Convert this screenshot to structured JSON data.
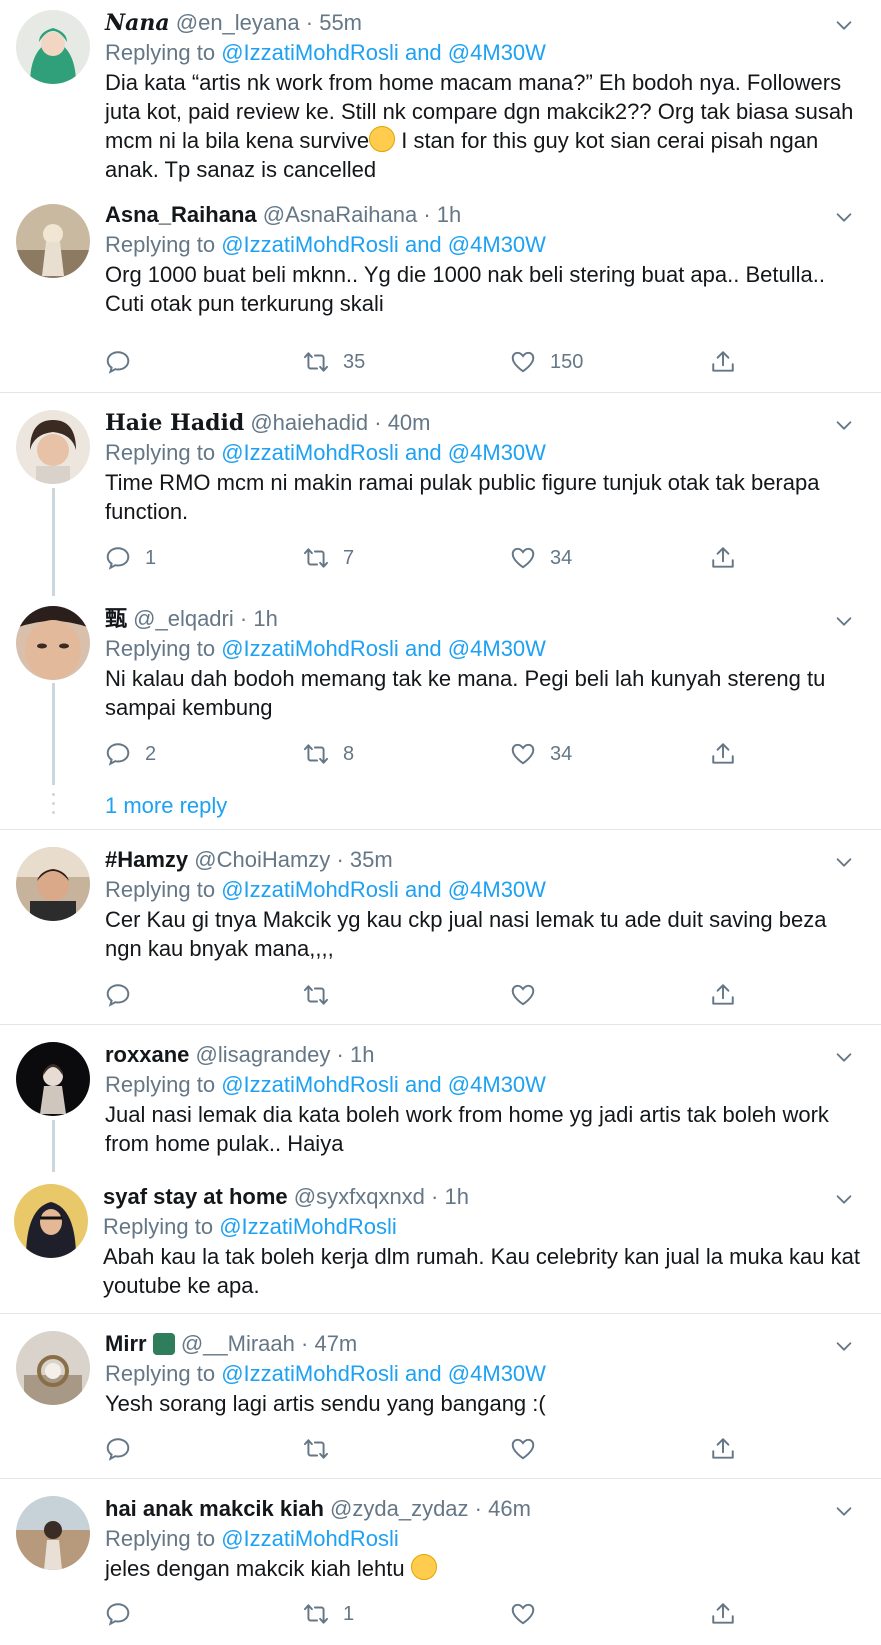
{
  "reply_prefix": "Replying to",
  "tweets": [
    {
      "name": "𝑵𝒂𝒏𝒂",
      "handle": "@en_leyana",
      "time": "55m",
      "mention_a": "@IzzatiMohdRosli",
      "and": "and",
      "mention_b": "@4M30W",
      "text_1": "Dia kata “artis nk work from home macam mana?” Eh bodoh nya. Followers juta kot, paid review ke. Still nk compare dgn makcik2?? Org tak biasa susah mcm ni la bila kena survive",
      "text_2": " I stan for this guy kot sian cerai pisah ngan anak. Tp sanaz is cancelled"
    },
    {
      "name": "Asna_Raihana",
      "handle": "@AsnaRaihana",
      "time": "1h",
      "mention_a": "@IzzatiMohdRosli",
      "and": "and",
      "mention_b": "@4M30W",
      "text": "Org 1000 buat beli mknn.. Yg die 1000 nak beli stering buat apa.. Betulla.. Cuti otak pun terkurung skali",
      "retweets": "35",
      "likes": "150"
    },
    {
      "name": "Haie Hadid",
      "handle": "@haiehadid",
      "time": "40m",
      "mention_a": "@IzzatiMohdRosli",
      "and": "and",
      "mention_b": "@4M30W",
      "text": "Time RMO mcm ni makin ramai pulak public figure tunjuk otak tak berapa function.",
      "replies": "1",
      "retweets": "7",
      "likes": "34"
    },
    {
      "name": "甄",
      "handle": "@_elqadri",
      "time": "1h",
      "mention_a": "@IzzatiMohdRosli",
      "and": "and",
      "mention_b": "@4M30W",
      "text": "Ni kalau dah bodoh memang tak ke mana. Pegi beli lah kunyah stereng tu sampai kembung",
      "replies": "2",
      "retweets": "8",
      "likes": "34"
    },
    {
      "name": "#Hamzy",
      "handle": "@ChoiHamzy",
      "time": "35m",
      "mention_a": "@IzzatiMohdRosli",
      "and": "and",
      "mention_b": "@4M30W",
      "text": "Cer Kau gi tnya Makcik yg kau ckp jual nasi lemak tu ade duit saving beza ngn kau bnyak mana,,,,"
    },
    {
      "name": "roxxane",
      "handle": "@lisagrandey",
      "time": "1h",
      "mention_a": "@IzzatiMohdRosli",
      "and": "and",
      "mention_b": "@4M30W",
      "text": "Jual nasi lemak dia kata boleh work from home yg jadi artis tak boleh work from home pulak.. Haiya"
    },
    {
      "name": "syaf stay at home",
      "handle": "@syxfxqxnxd",
      "time": "1h",
      "mention_a": "@IzzatiMohdRosli",
      "text": "Abah kau la tak boleh kerja dlm rumah. Kau celebrity kan jual la muka kau kat youtube ke apa."
    },
    {
      "name": "Mirr",
      "handle": "@__Miraah",
      "time": "47m",
      "mention_a": "@IzzatiMohdRosli",
      "and": "and",
      "mention_b": "@4M30W",
      "text": "Yesh sorang lagi artis sendu yang bangang :("
    },
    {
      "name": "hai anak makcik kiah",
      "handle": "@zyda_zydaz",
      "time": "46m",
      "mention_a": "@IzzatiMohdRosli",
      "text": "jeles dengan makcik kiah lehtu",
      "retweets": "1"
    }
  ],
  "more_replies": "1 more reply",
  "sep_dot": "·",
  "icons": [
    "reply-icon",
    "retweet-icon",
    "like-icon",
    "share-icon",
    "chevron-down-icon"
  ],
  "colors": {
    "link": "#1da1f2",
    "muted": "#657786",
    "border": "#e1e8ed"
  }
}
